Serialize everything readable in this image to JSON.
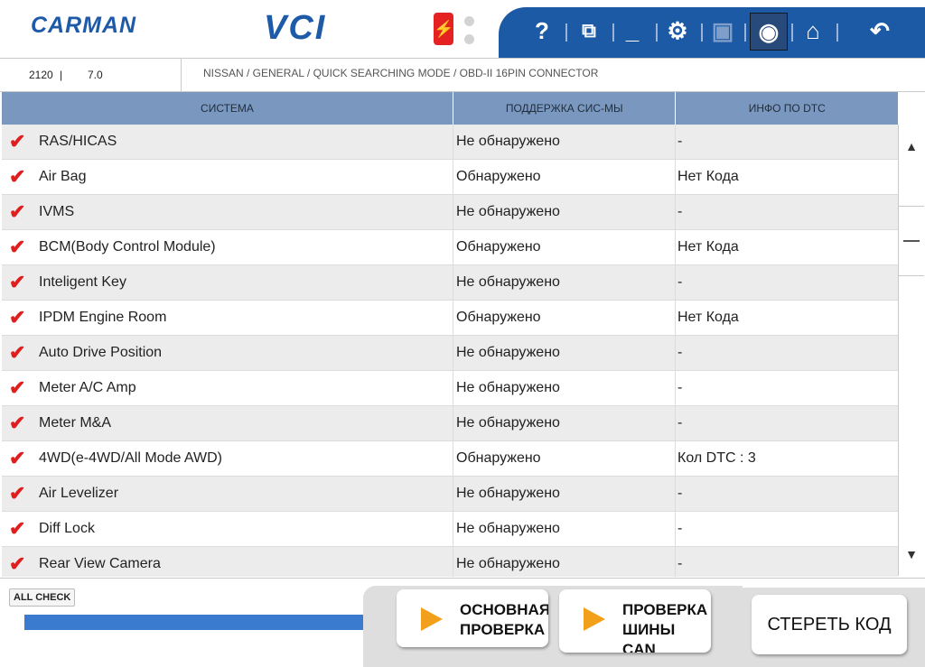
{
  "header": {
    "logo_text": "CARMAN",
    "app_title": "VCI"
  },
  "toolbar": {
    "items": [
      {
        "icon": "help-icon",
        "glyph": "?"
      },
      {
        "icon": "window-icon",
        "glyph": "⧉"
      },
      {
        "icon": "minimize-icon",
        "glyph": "_"
      },
      {
        "icon": "settings-icon",
        "glyph": "⚙"
      },
      {
        "icon": "save-icon",
        "glyph": "▣"
      },
      {
        "icon": "camera-icon",
        "glyph": "◉"
      },
      {
        "icon": "home-icon",
        "glyph": "⌂"
      },
      {
        "icon": "back-icon",
        "glyph": "↶"
      }
    ]
  },
  "info": {
    "code": "2120",
    "separator": "|",
    "version": "7.0",
    "breadcrumb": "NISSAN / GENERAL / QUICK SEARCHING MODE / OBD-II 16PIN CONNECTOR"
  },
  "table": {
    "headers": [
      "СИСТЕМА",
      "ПОДДЕРЖКА СИС-МЫ",
      "ИНФО ПО DTC"
    ],
    "rows": [
      {
        "system": "RAS/HICAS",
        "support": "Не обнаружено",
        "dtc": "-"
      },
      {
        "system": "Air Bag",
        "support": "Обнаружено",
        "dtc": "Нет Кода"
      },
      {
        "system": "IVMS",
        "support": "Не обнаружено",
        "dtc": "-"
      },
      {
        "system": "BCM(Body Control Module)",
        "support": "Обнаружено",
        "dtc": "Нет Кода"
      },
      {
        "system": "Inteligent Key",
        "support": "Не обнаружено",
        "dtc": "-"
      },
      {
        "system": "IPDM Engine Room",
        "support": "Обнаружено",
        "dtc": "Нет Кода"
      },
      {
        "system": "Auto Drive Position",
        "support": "Не обнаружено",
        "dtc": "-"
      },
      {
        "system": "Meter A/C Amp",
        "support": "Не обнаружено",
        "dtc": "-"
      },
      {
        "system": "Meter M&A",
        "support": "Не обнаружено",
        "dtc": "-"
      },
      {
        "system": "4WD(e-4WD/All Mode AWD)",
        "support": "Обнаружено",
        "dtc": "Кол DTC : 3"
      },
      {
        "system": "Air Levelizer",
        "support": "Не обнаружено",
        "dtc": "-"
      },
      {
        "system": "Diff Lock",
        "support": "Не обнаружено",
        "dtc": "-"
      },
      {
        "system": "Rear View Camera",
        "support": "Не обнаружено",
        "dtc": "-"
      }
    ]
  },
  "bottom": {
    "all_check": "ALL CHECK",
    "progress": 1.0,
    "main_check": "ОСНОВНАЯ\nПРОВЕРКА",
    "tire_check": "ПРОВЕРКА\nШИНЫ\nCAN",
    "erase_code": "СТЕРЕТЬ КОД"
  },
  "colors": {
    "accent": "#1d5aa6",
    "header_bg": "#7a98bf",
    "check": "#e01e1e",
    "progress": "#3a7bd0",
    "play": "#f2a01b"
  }
}
